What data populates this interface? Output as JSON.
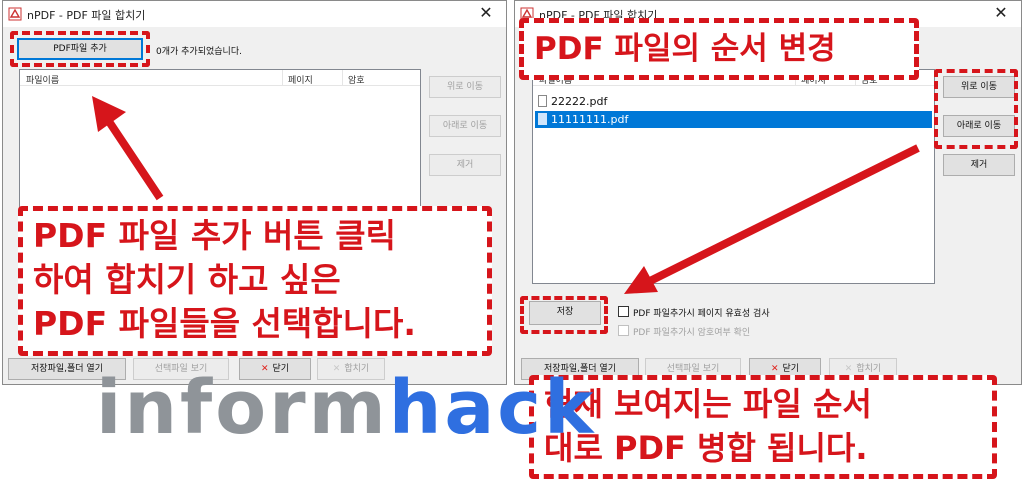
{
  "left_window": {
    "title": "nPDF - PDF 파일 합치기",
    "add_button": "PDF파일 추가",
    "added_count_text": "0개가 추가되었습니다.",
    "columns": [
      "파일이름",
      "페이지",
      "암호"
    ],
    "side_buttons": [
      "위로 이동",
      "아래로 이동",
      "제거"
    ],
    "bottom_buttons": {
      "save_folder": "저장파일,폴더 열기",
      "view_selected": "선택파일 보기",
      "close": "닫기",
      "merge": "합치기"
    }
  },
  "right_window": {
    "title": "nPDF - PDF 파일 합치기",
    "columns": [
      "파일이름",
      "페이지",
      "암호"
    ],
    "files": [
      {
        "name": "22222.pdf",
        "selected": false
      },
      {
        "name": "11111111.pdf",
        "selected": true
      }
    ],
    "side_buttons": [
      "위로 이동",
      "아래로 이동",
      "제거"
    ],
    "save_button": "저장",
    "options": [
      {
        "label": "PDF 파일추가시 페이지 유효성 검사",
        "checked": false,
        "enabled": true
      },
      {
        "label": "PDF 파일추가시 암호여부 확인",
        "checked": false,
        "enabled": false
      }
    ],
    "bottom_buttons": {
      "save_folder": "저장파일,폴더 열기",
      "view_selected": "선택파일 보기",
      "close": "닫기",
      "merge": "합치기"
    }
  },
  "annotations": {
    "left_callout": [
      "PDF 파일 추가 버튼 클릭",
      "하여 합치기 하고 싶은",
      "PDF 파일들을 선택합니다."
    ],
    "right_top_callout": "PDF 파일의 순서 변경",
    "right_bottom_callout": [
      "현재 보여지는 파일 순서",
      "대로 PDF 병합 됩니다."
    ]
  },
  "watermark": {
    "part1": "inform",
    "part2": "hack",
    "color1": "#8f9499",
    "color2": "#2f6fe0"
  },
  "colors": {
    "annotation_red": "#d6151b",
    "selection_blue": "#0078d7"
  }
}
